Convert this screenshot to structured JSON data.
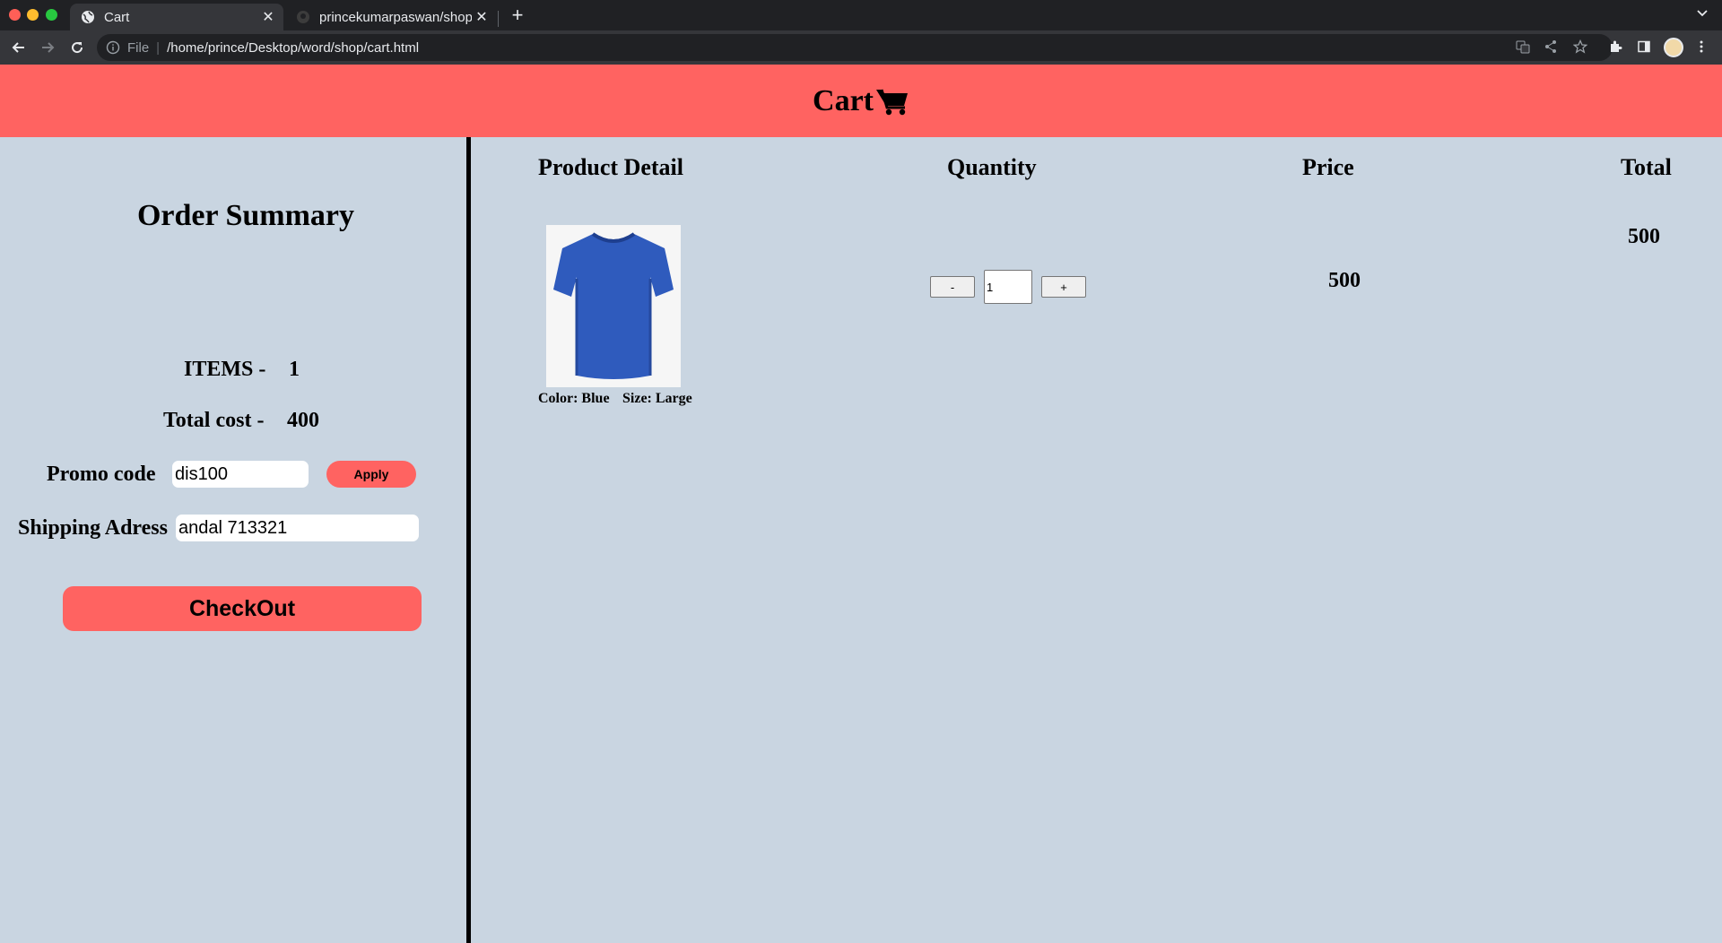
{
  "browser": {
    "tabs": [
      {
        "title": "Cart",
        "active": true
      },
      {
        "title": "princekumarpaswan/shop",
        "active": false
      }
    ],
    "address": {
      "scheme": "File",
      "url": "/home/prince/Desktop/word/shop/cart.html"
    }
  },
  "header": {
    "title": "Cart",
    "icon": "cart-icon"
  },
  "summary": {
    "title": "Order Summary",
    "items_label": "ITEMS -",
    "items_value": "1",
    "cost_label": "Total cost -",
    "cost_value": "400",
    "promo_label": "Promo code",
    "promo_value": "dis100",
    "apply_label": "Apply",
    "shipping_label": "Shipping Adress",
    "shipping_value": "andal 713321",
    "checkout_label": "CheckOut"
  },
  "table": {
    "headers": {
      "product": "Product Detail",
      "quantity": "Quantity",
      "price": "Price",
      "total": "Total"
    },
    "row": {
      "image": "blue-tshirt",
      "color_text": "Color: Blue",
      "size_text": "Size: Large",
      "minus_label": "-",
      "quantity": "1",
      "plus_label": "+",
      "price": "500",
      "total": "500"
    }
  },
  "colors": {
    "accent": "#ff6361",
    "background": "#c9d5e1",
    "tshirt": "#2f5bbd"
  }
}
